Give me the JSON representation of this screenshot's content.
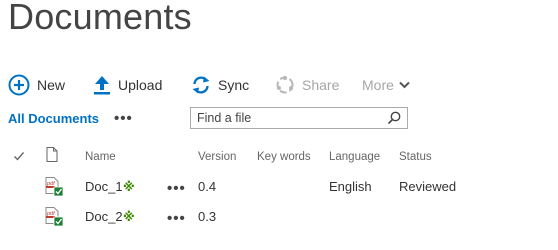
{
  "page": {
    "title": "Documents"
  },
  "commands": {
    "new": {
      "label": "New",
      "icon": "plus-circle-icon"
    },
    "upload": {
      "label": "Upload",
      "icon": "upload-arrow-icon"
    },
    "sync": {
      "label": "Sync",
      "icon": "sync-icon"
    },
    "share": {
      "label": "Share",
      "icon": "share-icon"
    },
    "more": {
      "label": "More",
      "icon": "chevron-down-icon"
    }
  },
  "view": {
    "current": "All Documents",
    "menu": "•••"
  },
  "search": {
    "placeholder": "Find a file"
  },
  "columns": {
    "name": "Name",
    "version": "Version",
    "keywords": "Key words",
    "language": "Language",
    "status": "Status"
  },
  "documents": [
    {
      "name": "Doc_1",
      "new_marker": "※",
      "menu": "•••",
      "version": "0.4",
      "keywords": "",
      "language": "English",
      "status": "Reviewed",
      "file_type": "pdf"
    },
    {
      "name": "Doc_2",
      "new_marker": "※",
      "menu": "•••",
      "version": "0.3",
      "keywords": "",
      "language": "",
      "status": "",
      "file_type": "pdf"
    }
  ],
  "colors": {
    "accent": "#0072c6",
    "new_marker": "#3a8a00",
    "disabled": "#a6a6a6"
  }
}
